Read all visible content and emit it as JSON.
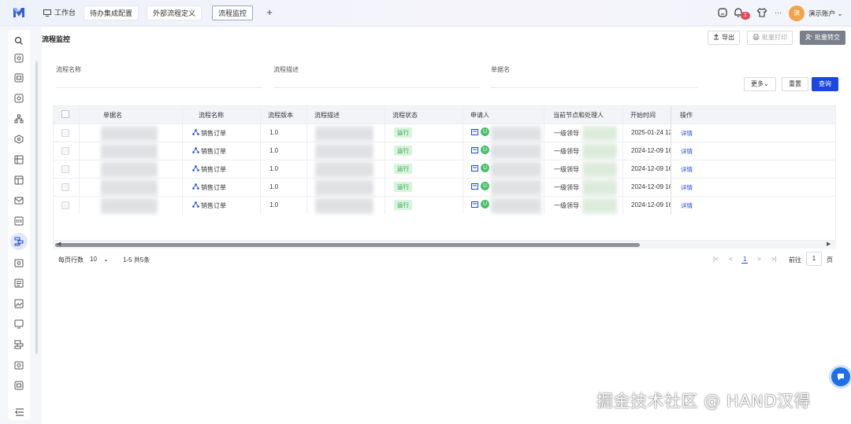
{
  "colors": {
    "primary": "#1b47e0",
    "status_green": "#2b9a46",
    "badge_red": "#e34d59",
    "avatar_orange": "#f3a34b"
  },
  "topbar": {
    "tabs": [
      {
        "label": "工作台"
      },
      {
        "label": "待办集成配置"
      },
      {
        "label": "外部流程定义"
      },
      {
        "label": "流程监控"
      }
    ],
    "add_tab": "+",
    "notification_count": "1",
    "more": "···",
    "avatar_text": "演",
    "account": "演示账户"
  },
  "header": {
    "title": "流程监控",
    "export_label": "导出",
    "batch_print_label": "批量打印",
    "batch_transfer_label": "批量转交"
  },
  "filters": {
    "fields": [
      {
        "label": "流程名称"
      },
      {
        "label": "流程描述"
      },
      {
        "label": "单据名"
      }
    ],
    "more_label": "更多",
    "reset_label": "重置",
    "query_label": "查询"
  },
  "table": {
    "columns": [
      "单据名",
      "流程名称",
      "流程版本",
      "流程描述",
      "流程状态",
      "申请人",
      "当前节点和处理人",
      "开始时间",
      "操作"
    ],
    "rows": [
      {
        "flow_name": "销售订单",
        "version": "1.0",
        "status": "运行",
        "applicant_initial": "U",
        "node": "一级领导",
        "start_time": "2025-01-24 12",
        "action": "详情"
      },
      {
        "flow_name": "销售订单",
        "version": "1.0",
        "status": "运行",
        "applicant_initial": "U",
        "node": "一级领导",
        "start_time": "2024-12-09 16",
        "action": "详情"
      },
      {
        "flow_name": "销售订单",
        "version": "1.0",
        "status": "运行",
        "applicant_initial": "U",
        "node": "一级领导",
        "start_time": "2024-12-09 16",
        "action": "详情"
      },
      {
        "flow_name": "销售订单",
        "version": "1.0",
        "status": "运行",
        "applicant_initial": "U",
        "node": "一级领导",
        "start_time": "2024-12-09 16",
        "action": "详情"
      },
      {
        "flow_name": "销售订单",
        "version": "1.0",
        "status": "运行",
        "applicant_initial": "U",
        "node": "一级领导",
        "start_time": "2024-12-09 16",
        "action": "详情"
      }
    ]
  },
  "pagination": {
    "page_size_label": "每页行数",
    "page_size": "10",
    "range": "1-5 共5条",
    "current_page": "1",
    "goto_label": "前往",
    "goto_value": "1",
    "page_unit": "页"
  },
  "watermark": "掘金技术社区 @ HAND汉得"
}
